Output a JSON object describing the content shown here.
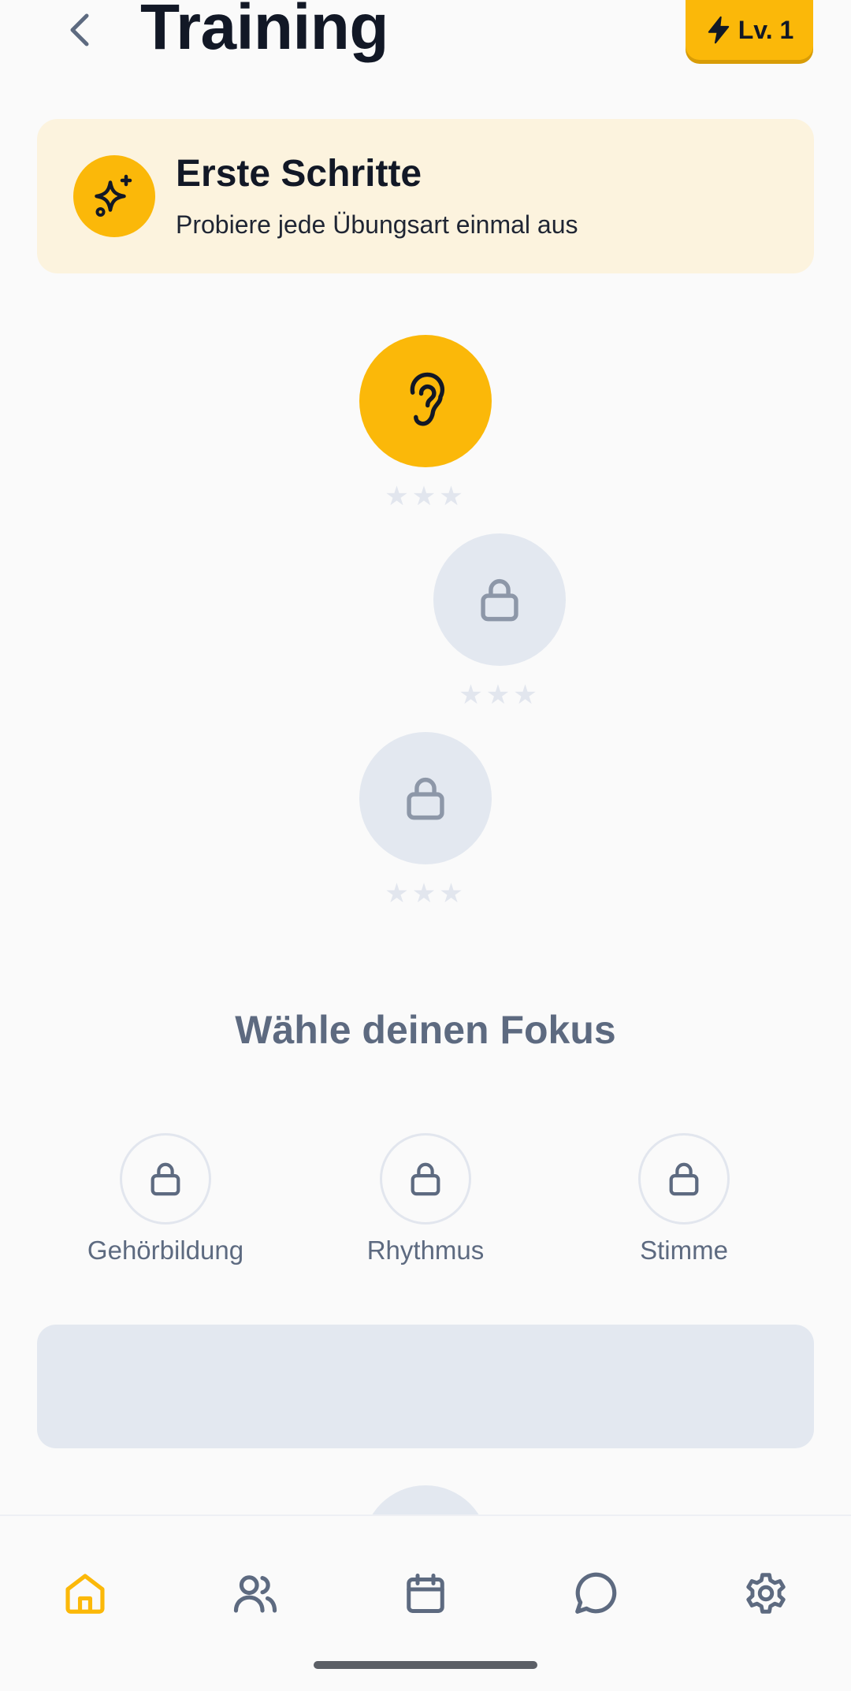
{
  "header": {
    "title": "Training",
    "level_label": "Lv. 1",
    "icons": {
      "back": "chevron-left-icon",
      "level": "lightning-icon"
    }
  },
  "challenge": {
    "title": "Erste Schritte",
    "subtitle": "Probiere jede Übungsart einmal aus",
    "icon": "sparkles-icon"
  },
  "path": {
    "nodes": [
      {
        "state": "active",
        "icon": "ear-icon",
        "stars": "★★★"
      },
      {
        "state": "locked",
        "icon": "lock-icon",
        "stars": "★★★"
      },
      {
        "state": "locked",
        "icon": "lock-icon",
        "stars": "★★★"
      }
    ]
  },
  "focus": {
    "heading": "Wähle deinen Fokus",
    "items": [
      {
        "label": "Gehörbildung",
        "icon": "lock-icon"
      },
      {
        "label": "Rhythmus",
        "icon": "lock-icon"
      },
      {
        "label": "Stimme",
        "icon": "lock-icon"
      }
    ]
  },
  "bottom_nav": {
    "items": [
      {
        "icon": "home-icon",
        "active": true
      },
      {
        "icon": "users-icon",
        "active": false
      },
      {
        "icon": "calendar-icon",
        "active": false
      },
      {
        "icon": "chat-icon",
        "active": false
      },
      {
        "icon": "settings-icon",
        "active": false
      }
    ]
  },
  "colors": {
    "accent": "#fbb809",
    "card_bg": "#fcf3de",
    "locked_bg": "#e3e8f0",
    "muted_text": "#5d6a80",
    "active_nav": "#fbb809",
    "inactive_nav": "#5d6a80"
  }
}
